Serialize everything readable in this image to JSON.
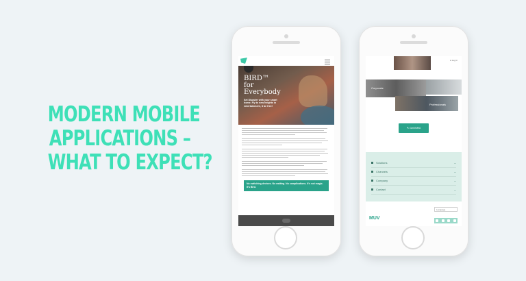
{
  "headline": {
    "lines": [
      "Modern mobile",
      "applications –",
      "what to expect?"
    ],
    "color": "#3ee0b7"
  },
  "left_phone": {
    "hero": {
      "title_line1": "BIRD™",
      "title_line2": "for",
      "title_line3": "Everybody",
      "subtitle": "Set Disaster with your smart home. Fly to new heights in entertainment, it be free!"
    },
    "promo": "No switching devices. No waiting. No complications. It’s not magic. It’s Bird."
  },
  "right_phone": {
    "account_label": "Log in",
    "tiles": {
      "corporate": "Corporate",
      "professionals": "Professionals"
    },
    "cta_button": "Get BIRD",
    "menu": [
      "Solutions",
      "Channels",
      "Company",
      "Contact"
    ],
    "language_input": "Language",
    "brand": "MUV",
    "accent_color": "#2aa38a",
    "menu_bg": "#daeee8"
  }
}
